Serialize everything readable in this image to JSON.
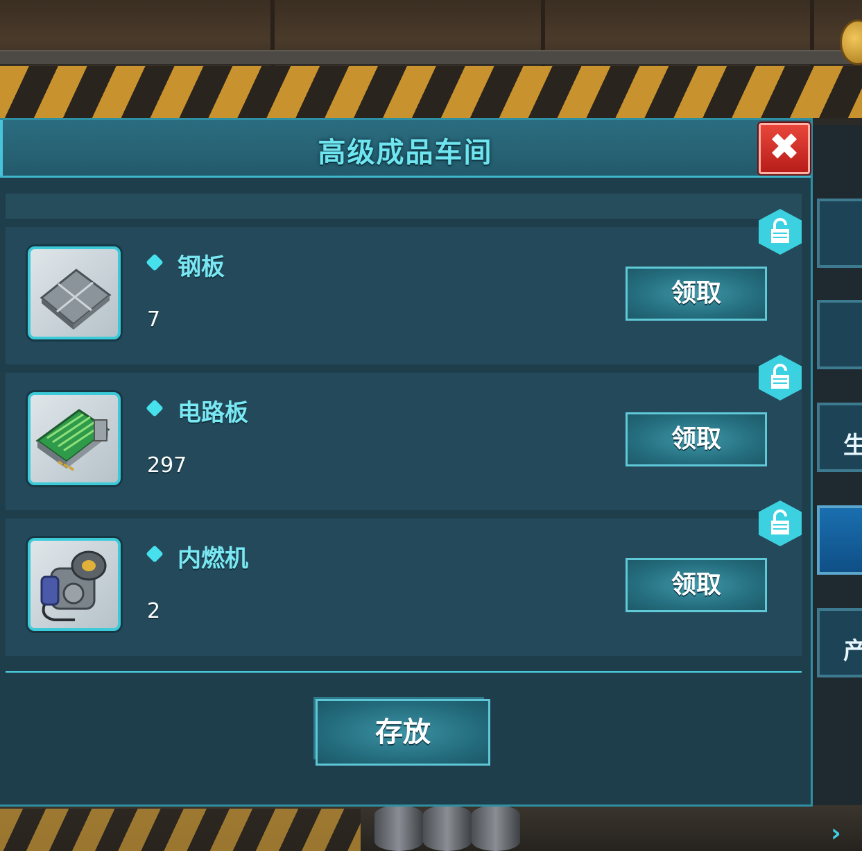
{
  "dialog": {
    "title": "高级成品车间",
    "close_label": "✖",
    "store_label": "存放"
  },
  "items": [
    {
      "name": "钢板",
      "count": "7",
      "claim_label": "领取",
      "icon": "steel-plate-icon"
    },
    {
      "name": "电路板",
      "count": "297",
      "claim_label": "领取",
      "icon": "circuit-board-icon"
    },
    {
      "name": "内燃机",
      "count": "2",
      "claim_label": "领取",
      "icon": "combustion-engine-icon"
    }
  ],
  "side_panel": {
    "partial_labels": [
      "生",
      "产"
    ]
  },
  "colors": {
    "accent": "#47e1ee",
    "close": "#d9342b",
    "panel": "#24495a"
  }
}
